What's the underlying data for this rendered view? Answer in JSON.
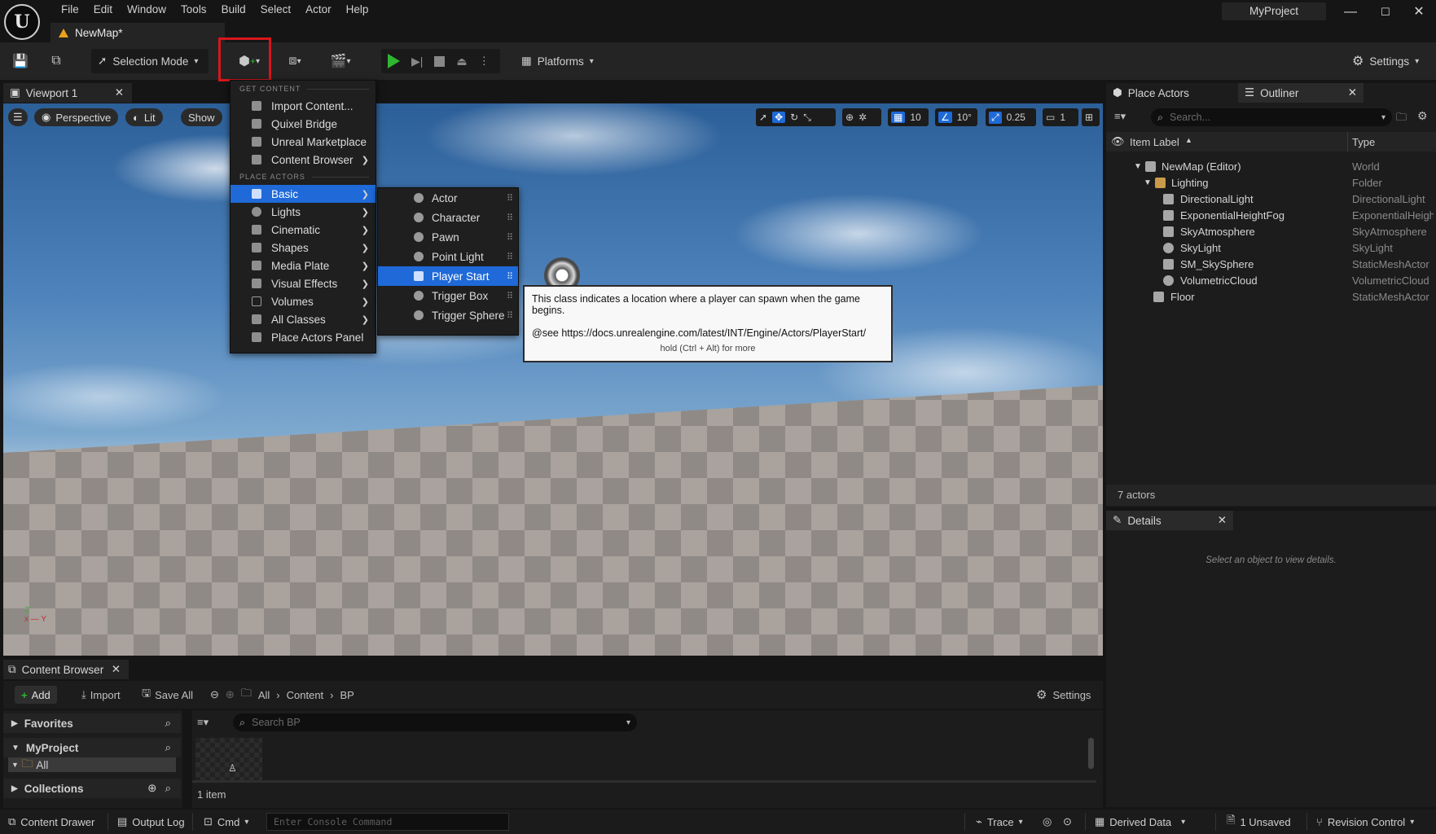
{
  "window": {
    "project_name": "MyProject",
    "map_tab": "NewMap*",
    "menu": [
      "File",
      "Edit",
      "Window",
      "Tools",
      "Build",
      "Select",
      "Actor",
      "Help"
    ],
    "controls": [
      "—",
      "☐",
      "✕"
    ]
  },
  "toolbar": {
    "selection_mode": "Selection Mode",
    "platforms": "Platforms",
    "settings": "Settings"
  },
  "viewport": {
    "tab_label": "Viewport 1",
    "perspective": "Perspective",
    "lit": "Lit",
    "show": "Show",
    "grid_snap": "10",
    "rotation_snap": "10°",
    "scale_snap": "0.25",
    "camera_speed": "1",
    "axis_z": "Z",
    "axis_xy": "x — Y"
  },
  "add_menu": {
    "section_get_content": "GET CONTENT",
    "get_content_items": [
      {
        "label": "Import Content...",
        "icon": "import-icon"
      },
      {
        "label": "Quixel Bridge",
        "icon": "bridge-icon"
      },
      {
        "label": "Unreal Marketplace",
        "icon": "marketplace-icon"
      },
      {
        "label": "Content Browser",
        "icon": "content-browser-icon",
        "submenu": true
      }
    ],
    "section_place_actors": "PLACE ACTORS",
    "place_actor_items": [
      {
        "label": "Basic",
        "icon": "basic-actor-icon",
        "submenu": true,
        "selected": true
      },
      {
        "label": "Lights",
        "icon": "light-bulb-icon",
        "submenu": true
      },
      {
        "label": "Cinematic",
        "icon": "cinematic-icon",
        "submenu": true
      },
      {
        "label": "Shapes",
        "icon": "shapes-icon",
        "submenu": true
      },
      {
        "label": "Media Plate",
        "icon": "media-plate-icon",
        "submenu": true
      },
      {
        "label": "Visual Effects",
        "icon": "visual-effects-icon",
        "submenu": true
      },
      {
        "label": "Volumes",
        "icon": "volume-icon",
        "submenu": true
      },
      {
        "label": "All Classes",
        "icon": "all-classes-icon",
        "submenu": true
      },
      {
        "label": "Place Actors Panel",
        "icon": "place-actors-icon"
      }
    ]
  },
  "basic_submenu": [
    {
      "label": "Actor",
      "icon": "actor-icon"
    },
    {
      "label": "Character",
      "icon": "character-icon"
    },
    {
      "label": "Pawn",
      "icon": "pawn-icon"
    },
    {
      "label": "Point Light",
      "icon": "point-light-icon"
    },
    {
      "label": "Player Start",
      "icon": "player-start-icon",
      "selected": true
    },
    {
      "label": "Trigger Box",
      "icon": "trigger-box-icon"
    },
    {
      "label": "Trigger Sphere",
      "icon": "trigger-sphere-icon"
    }
  ],
  "tooltip": {
    "line1": "This class indicates a location where a player can spawn when the game begins.",
    "line2": "@see https://docs.unrealengine.com/latest/INT/Engine/Actors/PlayerStart/",
    "hint": "hold (Ctrl + Alt) for more"
  },
  "right_tabs": {
    "place_actors": "Place Actors",
    "outliner": "Outliner",
    "details": "Details"
  },
  "outliner": {
    "search_placeholder": "Search...",
    "col_label": "Item Label",
    "col_type": "Type",
    "rows": [
      {
        "label": "NewMap (Editor)",
        "type": "World"
      },
      {
        "label": "Lighting",
        "type": "Folder"
      },
      {
        "label": "DirectionalLight",
        "type": "DirectionalLight"
      },
      {
        "label": "ExponentialHeightFog",
        "type": "ExponentialHeigh"
      },
      {
        "label": "SkyAtmosphere",
        "type": "SkyAtmosphere"
      },
      {
        "label": "SkyLight",
        "type": "SkyLight"
      },
      {
        "label": "SM_SkySphere",
        "type": "StaticMeshActor"
      },
      {
        "label": "VolumetricCloud",
        "type": "VolumetricCloud"
      },
      {
        "label": "Floor",
        "type": "StaticMeshActor"
      }
    ],
    "count": "7 actors"
  },
  "details": {
    "empty_message": "Select an object to view details."
  },
  "content_browser": {
    "tab_label": "Content Browser",
    "add": "Add",
    "import": "Import",
    "save_all": "Save All",
    "path": [
      "All",
      "Content",
      "BP"
    ],
    "settings": "Settings",
    "favorites": "Favorites",
    "project": "MyProject",
    "all": "All",
    "collections": "Collections",
    "search_placeholder": "Search BP",
    "item_count": "1 item"
  },
  "status_bar": {
    "content_drawer": "Content Drawer",
    "output_log": "Output Log",
    "cmd": "Cmd",
    "console_placeholder": "Enter Console Command",
    "trace": "Trace",
    "derived_data": "Derived Data",
    "unsaved": "1 Unsaved",
    "revision_control": "Revision Control"
  },
  "colors": {
    "accent": "#1f6ad8",
    "highlight_box": "#d8161c",
    "play_green": "#2fb62f"
  }
}
